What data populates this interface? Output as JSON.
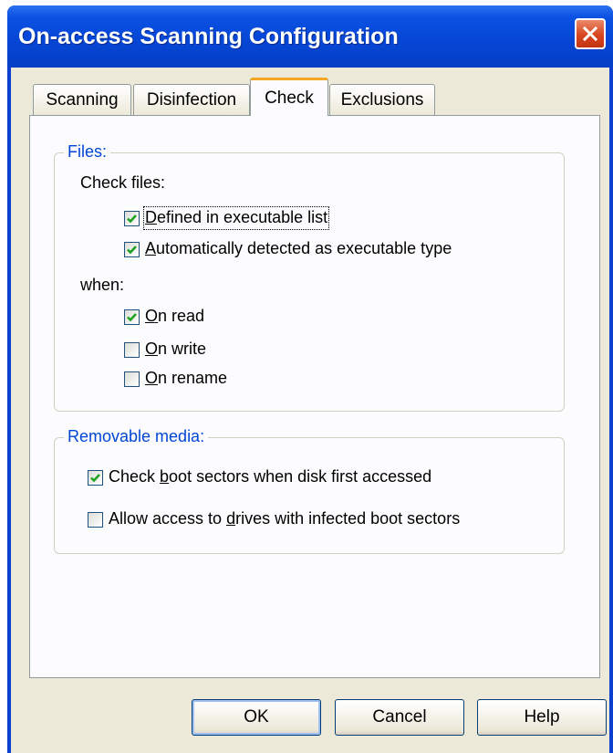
{
  "window": {
    "title": "On-access Scanning Configuration"
  },
  "tabs": [
    {
      "label": "Scanning",
      "active": false
    },
    {
      "label": "Disinfection",
      "active": false
    },
    {
      "label": "Check",
      "active": true
    },
    {
      "label": "Exclusions",
      "active": false
    }
  ],
  "files_group": {
    "legend": "Files:",
    "check_files_label": "Check files:",
    "when_label": "when:",
    "check_options": [
      {
        "mnemonic": "D",
        "rest": "efined in executable list",
        "checked": true
      },
      {
        "mnemonic": "A",
        "rest": "utomatically detected as executable type",
        "checked": true
      }
    ],
    "when_options": [
      {
        "mnemonic": "O",
        "rest": "n read",
        "checked": true
      },
      {
        "mnemonic": "O",
        "rest": "n write",
        "checked": false
      },
      {
        "mnemonic": "O",
        "rest": "n rename",
        "checked": false
      }
    ]
  },
  "removable_group": {
    "legend": "Removable media:",
    "options": [
      {
        "pre": "Check ",
        "mnemonic": "b",
        "post": "oot sectors when disk first accessed",
        "checked": true
      },
      {
        "pre": "Allow access to ",
        "mnemonic": "d",
        "post": "rives with infected boot sectors",
        "checked": false
      }
    ]
  },
  "buttons": {
    "ok": "OK",
    "cancel": "Cancel",
    "help": "Help"
  },
  "colors": {
    "titlebar": "#0646d6",
    "dialog_bg": "#ece9d8",
    "group_legend": "#0046d5",
    "close_button": "#d8451f",
    "active_tab_accent": "#f5a623"
  }
}
